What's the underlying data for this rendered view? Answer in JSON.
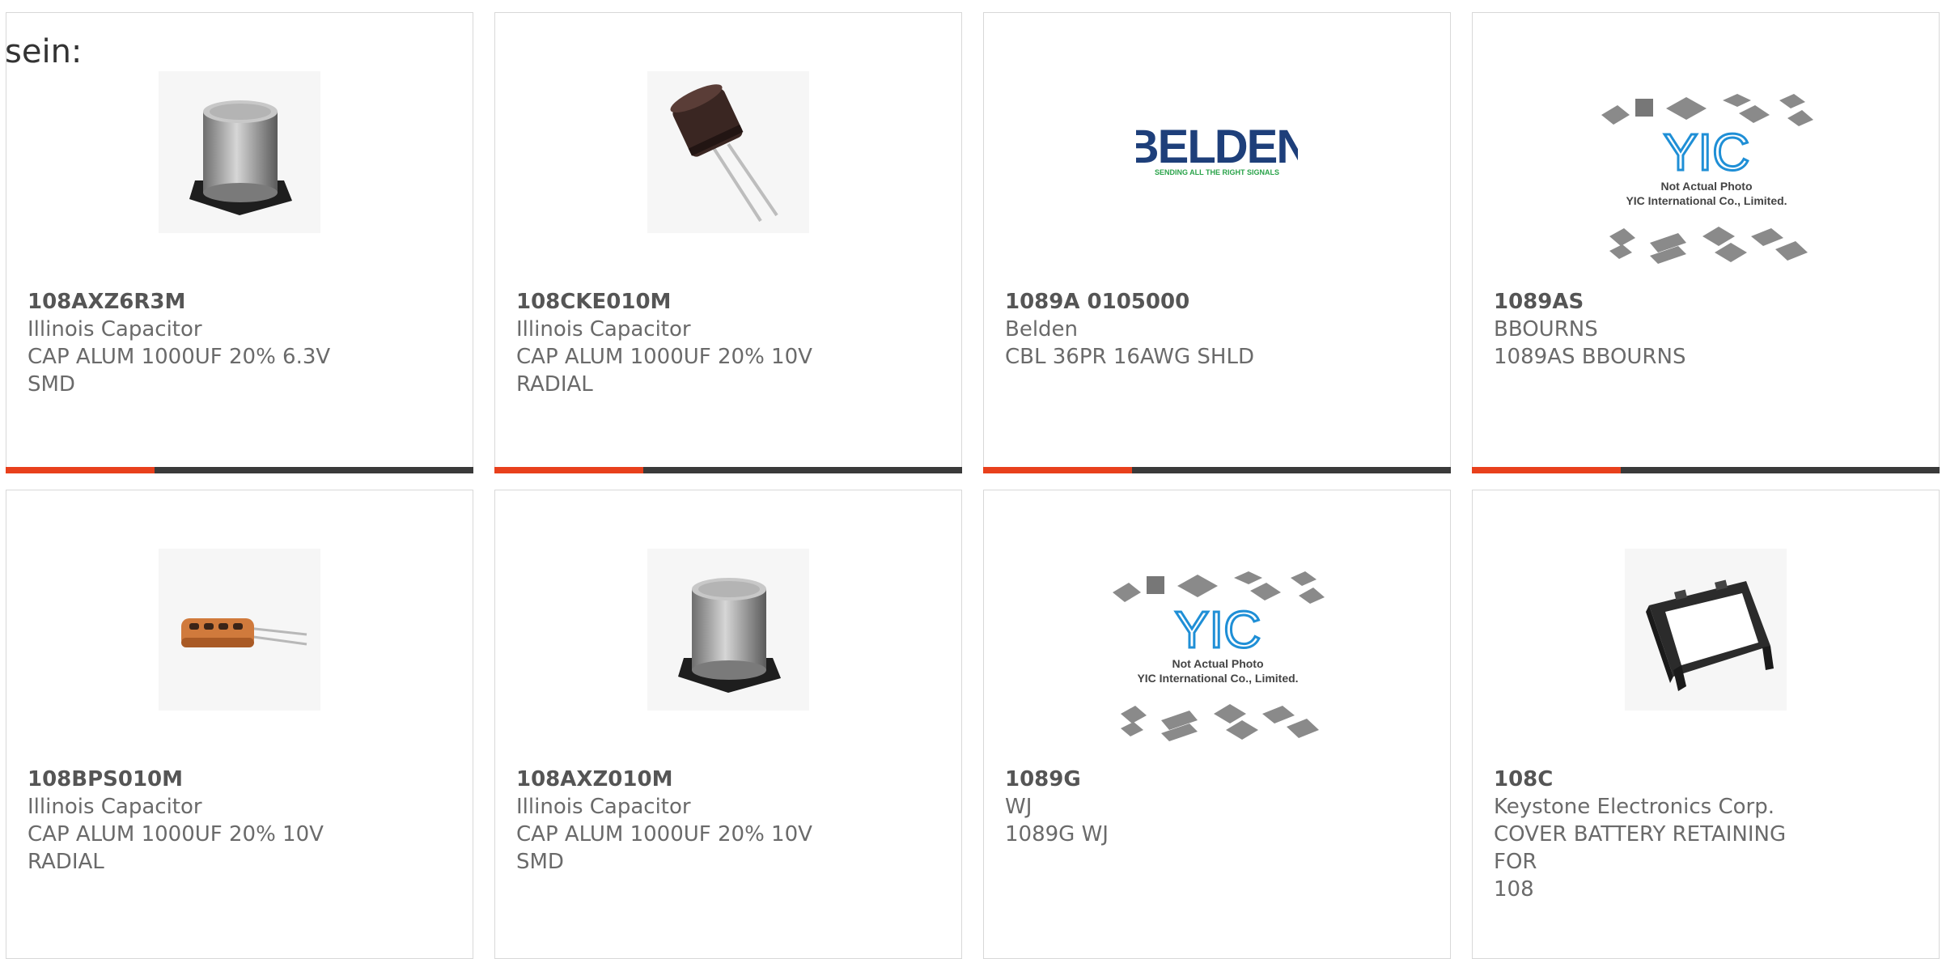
{
  "page": {
    "heading": "sein:"
  },
  "colors": {
    "accent": "#e8401c",
    "bar": "#3a3a3a",
    "border": "#d8d8d8",
    "text": "#6a6a6a"
  },
  "products": [
    {
      "part": "108AXZ6R3M",
      "manufacturer": "Illinois Capacitor",
      "desc1": "CAP ALUM 1000UF 20% 6.3V",
      "desc2": "SMD",
      "image": "smd-capacitor-icon"
    },
    {
      "part": "108CKE010M",
      "manufacturer": "Illinois Capacitor",
      "desc1": "CAP ALUM 1000UF 20% 10V",
      "desc2": "RADIAL",
      "image": "radial-capacitor-icon"
    },
    {
      "part": "1089A 0105000",
      "manufacturer": "Belden",
      "desc1": "CBL 36PR 16AWG SHLD",
      "desc2": "",
      "image": "belden-logo",
      "logo": {
        "name": "BELDEN",
        "tagline": "SENDING ALL THE RIGHT SIGNALS"
      }
    },
    {
      "part": "1089AS",
      "manufacturer": "BBOURNS",
      "desc1": "1089AS BBOURNS",
      "desc2": "",
      "image": "yic-placeholder",
      "placeholder": {
        "logo": "YIC",
        "line1": "Not Actual Photo",
        "line2": "YIC International Co., Limited."
      }
    },
    {
      "part": "108BPS010M",
      "manufacturer": "Illinois Capacitor",
      "desc1": "CAP ALUM 1000UF 20% 10V",
      "desc2": "RADIAL",
      "image": "axial-capacitor-icon"
    },
    {
      "part": "108AXZ010M",
      "manufacturer": "Illinois Capacitor",
      "desc1": "CAP ALUM 1000UF 20% 10V SMD",
      "desc2": "",
      "image": "smd-capacitor-icon"
    },
    {
      "part": "1089G",
      "manufacturer": "WJ",
      "desc1": "1089G WJ",
      "desc2": "",
      "image": "yic-placeholder",
      "placeholder": {
        "logo": "YIC",
        "line1": "Not Actual Photo",
        "line2": "YIC International Co., Limited."
      }
    },
    {
      "part": "108C",
      "manufacturer": "Keystone Electronics Corp.",
      "desc1": "COVER BATTERY RETAINING FOR",
      "desc2": "108",
      "image": "battery-cover-icon"
    }
  ]
}
